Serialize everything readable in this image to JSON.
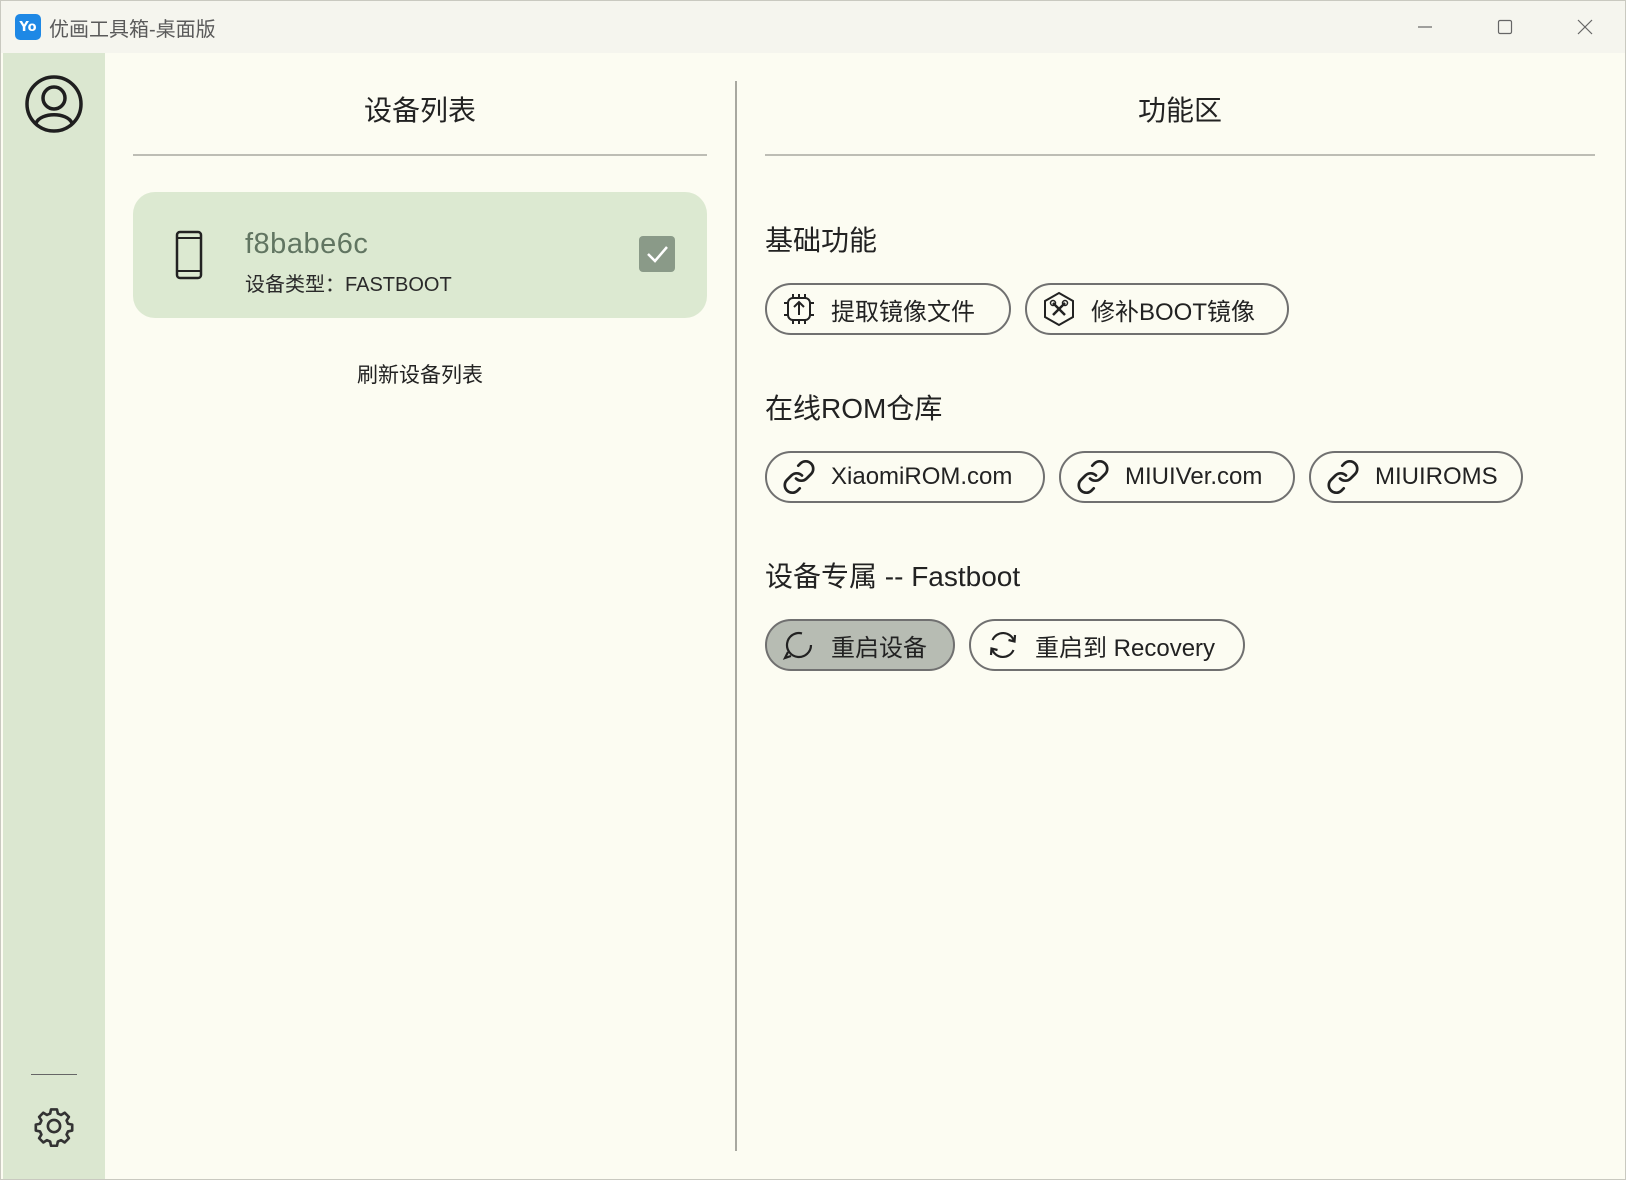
{
  "window": {
    "logo_text": "Yo",
    "title": "优画工具箱-桌面版",
    "controls": [
      "minimize-icon",
      "maximize-icon",
      "close-icon"
    ]
  },
  "rail": {
    "top_icon": "account-circle-icon",
    "bottom_icon": "gear-icon"
  },
  "device_panel": {
    "title": "设备列表",
    "devices": [
      {
        "id": "f8babe6c",
        "type_label": "设备类型：FASTBOOT",
        "selected": true
      }
    ],
    "refresh_label": "刷新设备列表"
  },
  "function_panel": {
    "title": "功能区",
    "sections": [
      {
        "label": "基础功能",
        "buttons": [
          {
            "label": "提取镜像文件",
            "icon": "upload-chip-icon"
          },
          {
            "label": "修补BOOT镜像",
            "icon": "tools-hexagon-icon"
          }
        ]
      },
      {
        "label": "在线ROM仓库",
        "buttons": [
          {
            "label": "XiaomiROM.com",
            "icon": "link-icon"
          },
          {
            "label": "MIUIVer.com",
            "icon": "link-icon"
          },
          {
            "label": "MIUIROMS",
            "icon": "link-icon"
          }
        ]
      },
      {
        "label": "设备专属 -- Fastboot",
        "buttons": [
          {
            "label": "重启设备",
            "icon": "restart-icon",
            "active": true
          },
          {
            "label": "重启到 Recovery",
            "icon": "sync-icon"
          }
        ]
      }
    ]
  },
  "colors": {
    "rail_bg": "#dbe7d0",
    "card_bg": "#dce9d1",
    "page_bg": "#fcfcf2",
    "active_chip_bg": "#b7bcb3"
  }
}
